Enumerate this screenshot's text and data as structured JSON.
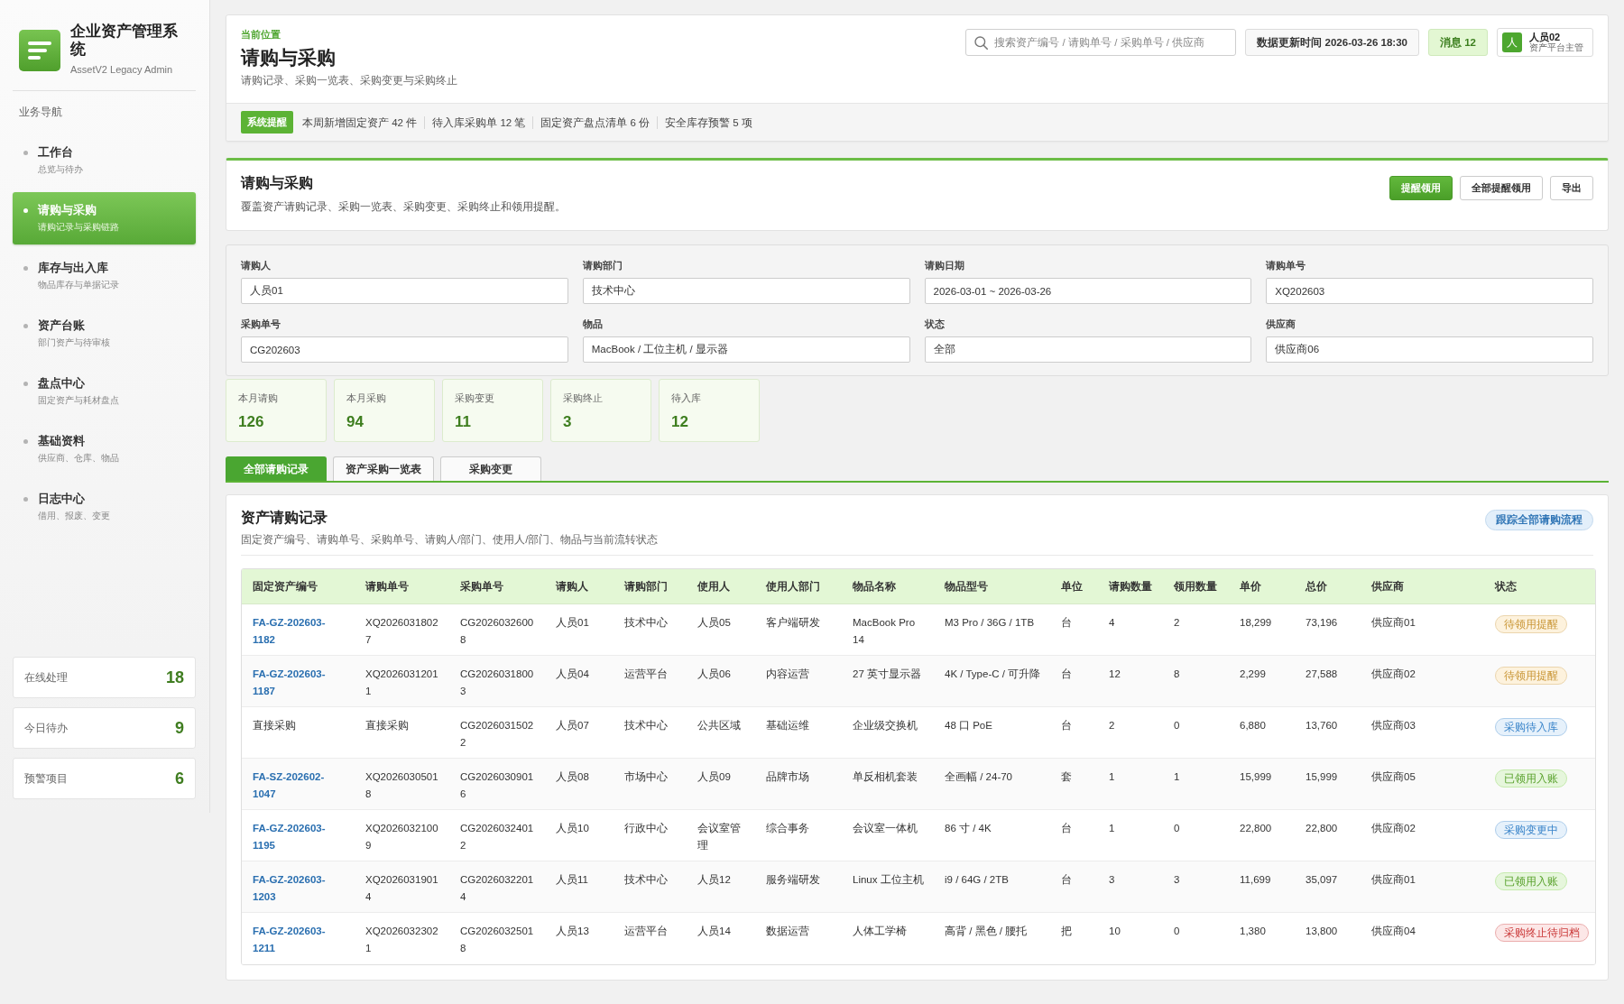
{
  "sidebar": {
    "brand": {
      "title": "企业资产管理系统",
      "subtitle": "AssetV2 Legacy Admin"
    },
    "nav_heading": "业务导航",
    "nav_items": [
      {
        "label": "工作台",
        "caption": "总览与待办",
        "selected": false
      },
      {
        "label": "请购与采购",
        "caption": "请购记录与采购链路",
        "selected": true
      },
      {
        "label": "库存与出入库",
        "caption": "物品库存与单据记录",
        "selected": false
      },
      {
        "label": "资产台账",
        "caption": "部门资产与待审核",
        "selected": false
      },
      {
        "label": "盘点中心",
        "caption": "固定资产与耗材盘点",
        "selected": false
      },
      {
        "label": "基础资料",
        "caption": "供应商、仓库、物品",
        "selected": false
      },
      {
        "label": "日志中心",
        "caption": "借用、报废、变更",
        "selected": false
      }
    ],
    "summary": [
      {
        "label": "在线处理",
        "value": "18"
      },
      {
        "label": "今日待办",
        "value": "9"
      },
      {
        "label": "预警项目",
        "value": "6"
      }
    ]
  },
  "header": {
    "breadcrumb": "当前位置",
    "title": "请购与采购",
    "subtitle": "请购记录、采购一览表、采购变更与采购终止",
    "search": {
      "placeholder": "搜索资产编号 / 请购单号 / 采购单号 / 供应商"
    },
    "updated": "数据更新时间 2026-03-26 18:30",
    "messages": "消息 12",
    "user": {
      "avatar": "人",
      "name": "人员02",
      "role": "资产平台主管"
    }
  },
  "alerts": {
    "badge": "系统提醒",
    "items": [
      "本周新增固定资产 42 件",
      "待入库采购单 12 笔",
      "固定资产盘点清单 6 份",
      "安全库存预警 5 项"
    ]
  },
  "section": {
    "title": "请购与采购",
    "description": "覆盖资产请购记录、采购一览表、采购变更、采购终止和领用提醒。",
    "buttons": [
      {
        "label": "提醒领用",
        "primary": true
      },
      {
        "label": "全部提醒领用",
        "primary": false
      },
      {
        "label": "导出",
        "primary": false
      }
    ]
  },
  "filters": [
    {
      "label": "请购人",
      "value": "人员01"
    },
    {
      "label": "请购部门",
      "value": "技术中心"
    },
    {
      "label": "请购日期",
      "value": "2026-03-01 ~ 2026-03-26"
    },
    {
      "label": "请购单号",
      "value": "XQ202603"
    },
    {
      "label": "采购单号",
      "value": "CG202603"
    },
    {
      "label": "物品",
      "value": "MacBook / 工位主机 / 显示器"
    },
    {
      "label": "状态",
      "value": "全部"
    },
    {
      "label": "供应商",
      "value": "供应商06"
    }
  ],
  "stats": [
    {
      "label": "本月请购",
      "value": "126"
    },
    {
      "label": "本月采购",
      "value": "94"
    },
    {
      "label": "采购变更",
      "value": "11"
    },
    {
      "label": "采购终止",
      "value": "3"
    },
    {
      "label": "待入库",
      "value": "12"
    }
  ],
  "tabs": [
    {
      "label": "全部请购记录",
      "selected": true
    },
    {
      "label": "资产采购一览表",
      "selected": false
    },
    {
      "label": "采购变更",
      "selected": false
    }
  ],
  "records": {
    "title": "资产请购记录",
    "description": "固定资产编号、请购单号、采购单号、请购人/部门、使用人/部门、物品与当前流转状态",
    "action": "跟踪全部请购流程",
    "columns": [
      "固定资产编号",
      "请购单号",
      "采购单号",
      "请购人",
      "请购部门",
      "使用人",
      "使用人部门",
      "物品名称",
      "物品型号",
      "单位",
      "请购数量",
      "领用数量",
      "单价",
      "总价",
      "供应商",
      "状态"
    ],
    "rows": [
      {
        "linked": true,
        "color": "#fdf2dd",
        "cells": [
          "FA-GZ-202603-1182",
          "XQ20260318027",
          "CG20260326008",
          "人员01",
          "技术中心",
          "人员05",
          "客户端研发",
          "MacBook Pro 14",
          "M3 Pro / 36G / 1TB",
          "台",
          "4",
          "2",
          "18,299",
          "73,196",
          "供应商01",
          "待领用提醒"
        ]
      },
      {
        "linked": true,
        "color": "#fdf2dd",
        "cells": [
          "FA-GZ-202603-1187",
          "XQ20260312011",
          "CG20260318003",
          "人员04",
          "运营平台",
          "人员06",
          "内容运营",
          "27 英寸显示器",
          "4K / Type-C / 可升降",
          "台",
          "12",
          "8",
          "2,299",
          "27,588",
          "供应商02",
          "待领用提醒"
        ]
      },
      {
        "linked": false,
        "color": "#e6f1fb",
        "cells": [
          "直接采购",
          "直接采购",
          "CG20260315022",
          "人员07",
          "技术中心",
          "公共区域",
          "基础运维",
          "企业级交换机",
          "48 口 PoE",
          "台",
          "2",
          "0",
          "6,880",
          "13,760",
          "供应商03",
          "采购待入库"
        ]
      },
      {
        "linked": true,
        "color": "#e6f6dc",
        "cells": [
          "FA-SZ-202602-1047",
          "XQ20260305018",
          "CG20260309016",
          "人员08",
          "市场中心",
          "人员09",
          "品牌市场",
          "单反相机套装",
          "全画幅 / 24-70",
          "套",
          "1",
          "1",
          "15,999",
          "15,999",
          "供应商05",
          "已领用入账"
        ]
      },
      {
        "linked": true,
        "color": "#e6f1fb",
        "cells": [
          "FA-GZ-202603-1195",
          "XQ20260321009",
          "CG20260324012",
          "人员10",
          "行政中心",
          "会议室管理",
          "综合事务",
          "会议室一体机",
          "86 寸 / 4K",
          "台",
          "1",
          "0",
          "22,800",
          "22,800",
          "供应商02",
          "采购变更中"
        ]
      },
      {
        "linked": true,
        "color": "#e6f6dc",
        "cells": [
          "FA-GZ-202603-1203",
          "XQ20260319014",
          "CG20260322014",
          "人员11",
          "技术中心",
          "人员12",
          "服务端研发",
          "Linux 工位主机",
          "i9 / 64G / 2TB",
          "台",
          "3",
          "3",
          "11,699",
          "35,097",
          "供应商01",
          "已领用入账"
        ]
      },
      {
        "linked": true,
        "color": "#fce7e7",
        "cells": [
          "FA-GZ-202603-1211",
          "XQ20260323021",
          "CG20260325018",
          "人员13",
          "运营平台",
          "人员14",
          "数据运营",
          "人体工学椅",
          "高背 / 黑色 / 腰托",
          "把",
          "10",
          "0",
          "1,380",
          "13,800",
          "供应商04",
          "采购终止待归档"
        ]
      }
    ]
  }
}
